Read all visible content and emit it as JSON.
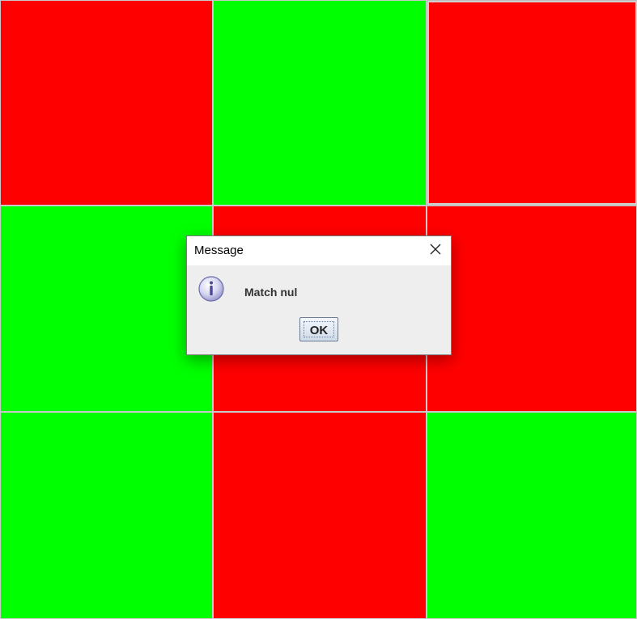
{
  "board": {
    "cells": [
      {
        "color": "red"
      },
      {
        "color": "green"
      },
      {
        "color": "red"
      },
      {
        "color": "green"
      },
      {
        "color": "red"
      },
      {
        "color": "red"
      },
      {
        "color": "green"
      },
      {
        "color": "red"
      },
      {
        "color": "green"
      }
    ],
    "colors": {
      "red": "#ff0000",
      "green": "#00ff00"
    }
  },
  "dialog": {
    "title": "Message",
    "message": "Match nul",
    "ok_label": "OK",
    "icon": "info-icon",
    "close_icon": "close-icon"
  }
}
